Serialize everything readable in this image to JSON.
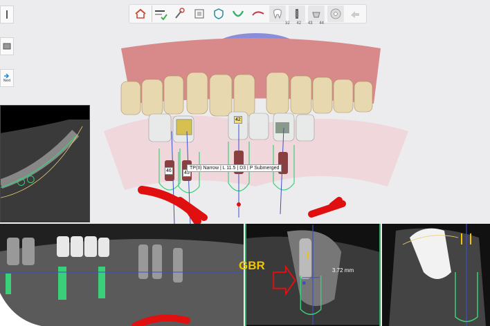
{
  "toolbar": {
    "items": [
      {
        "name": "home",
        "icon": "home-icon"
      },
      {
        "name": "step-check",
        "icon": "checklist-icon"
      },
      {
        "name": "tools",
        "icon": "tools-icon"
      },
      {
        "name": "ct",
        "icon": "ct-icon"
      },
      {
        "name": "shield",
        "icon": "shield-icon"
      },
      {
        "name": "arch",
        "icon": "arch-icon"
      },
      {
        "name": "curve",
        "icon": "curve-icon"
      },
      {
        "name": "tooth",
        "icon": "tooth-icon"
      },
      {
        "name": "implant",
        "icon": "implant-icon"
      },
      {
        "name": "abutment",
        "icon": "abutment-icon"
      },
      {
        "name": "guide",
        "icon": "guide-icon"
      },
      {
        "name": "share",
        "icon": "share-icon"
      }
    ],
    "tooth_tabs": [
      "32",
      "42",
      "43",
      "44"
    ]
  },
  "left_tools": [
    {
      "icon": "implant-small-icon",
      "label": ""
    },
    {
      "icon": "sleeve-icon",
      "label": ""
    },
    {
      "icon": "next-icon",
      "label": "Next"
    }
  ],
  "viewport": {
    "implant_tags": [
      "46",
      "45",
      "42"
    ],
    "implant_info": "TP(II) Narrow | L 11.5 | D3 | P Submerged"
  },
  "annotations": {
    "gbr": "GBR",
    "distance": "3.72 mm"
  },
  "colors": {
    "accent_green": "#3ad07a",
    "gum_pink": "#d88a8a",
    "arrow_red": "#e01010",
    "gbr_yellow": "#f5c400",
    "implant_blue": "#3a4ec8"
  }
}
